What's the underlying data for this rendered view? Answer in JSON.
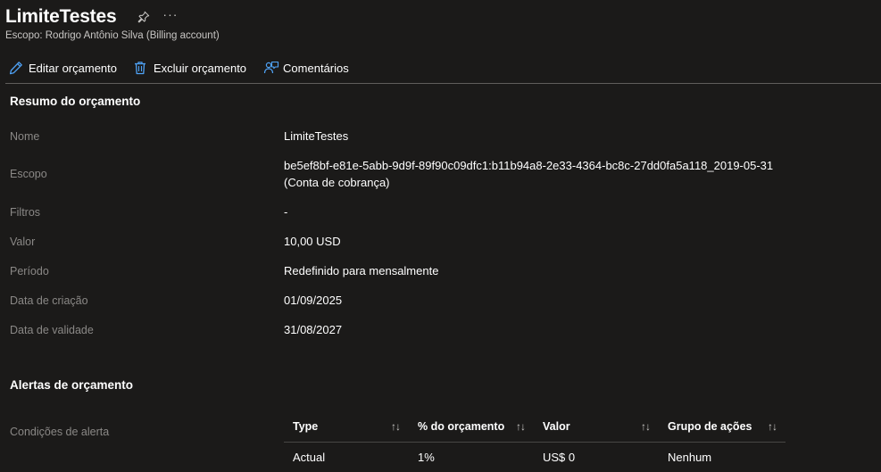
{
  "header": {
    "title": "LimiteTestes",
    "more_label": "···",
    "subtitle": "Escopo: Rodrigo Antônio Silva (Billing account)"
  },
  "toolbar": {
    "edit_label": "Editar orçamento",
    "delete_label": "Excluir orçamento",
    "comments_label": "Comentários"
  },
  "colors": {
    "background": "#1b1a19",
    "accent_blue": "#4fa3f7",
    "muted_text": "#8a8886"
  },
  "summary": {
    "title": "Resumo do orçamento",
    "rows": [
      {
        "label": "Nome",
        "value": "LimiteTestes"
      },
      {
        "label": "Escopo",
        "value": "be5ef8bf-e81e-5abb-9d9f-89f90c09dfc1:b11b94a8-2e33-4364-bc8c-27dd0fa5a118_2019-05-31 (Conta de cobrança)"
      },
      {
        "label": "Filtros",
        "value": "-"
      },
      {
        "label": "Valor",
        "value": "10,00 USD"
      },
      {
        "label": "Período",
        "value": "Redefinido para mensalmente"
      },
      {
        "label": "Data de criação",
        "value": "01/09/2025"
      },
      {
        "label": "Data de validade",
        "value": "31/08/2027"
      }
    ]
  },
  "alerts": {
    "title": "Alertas de orçamento",
    "conditions_label": "Condições de alerta",
    "columns": [
      "Type",
      "% do orçamento",
      "Valor",
      "Grupo de ações"
    ],
    "rows": [
      [
        "Actual",
        "1%",
        "US$ 0",
        "Nenhum"
      ]
    ]
  }
}
